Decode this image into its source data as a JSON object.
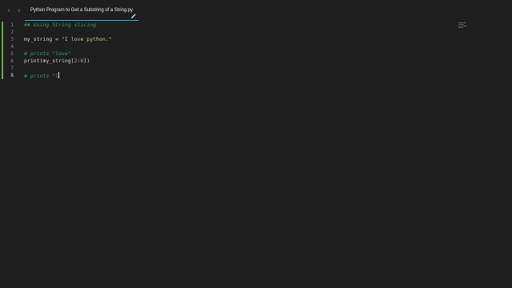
{
  "window": {
    "tab_title": "Python Program to Get a Substring of a String.py",
    "nav_back_icon": "chevron-left",
    "nav_forward_icon": "chevron-right",
    "tab_icon": "pencil-icon",
    "accent_color": "#2fb5c7"
  },
  "editor": {
    "active_line": 8,
    "modified_line_color": "#6fa04a",
    "lines": [
      {
        "number": "1",
        "tokens": [
          {
            "type": "comment",
            "text": "## Using String slicing"
          }
        ]
      },
      {
        "number": "2",
        "tokens": []
      },
      {
        "number": "3",
        "tokens": [
          {
            "type": "ident",
            "text": "my_string"
          },
          {
            "type": "op",
            "text": " = "
          },
          {
            "type": "str",
            "text": "\"I love python.\""
          }
        ]
      },
      {
        "number": "4",
        "tokens": []
      },
      {
        "number": "5",
        "tokens": [
          {
            "type": "comment",
            "text": "# prints \"love\""
          }
        ]
      },
      {
        "number": "6",
        "tokens": [
          {
            "type": "fn",
            "text": "print"
          },
          {
            "type": "bracket",
            "text": "("
          },
          {
            "type": "ident",
            "text": "my_string"
          },
          {
            "type": "bracket",
            "text": "["
          },
          {
            "type": "num",
            "text": "2"
          },
          {
            "type": "op",
            "text": ":"
          },
          {
            "type": "num",
            "text": "6"
          },
          {
            "type": "bracket",
            "text": "])"
          }
        ]
      },
      {
        "number": "7",
        "tokens": []
      },
      {
        "number": "8",
        "tokens": [
          {
            "type": "comment",
            "text": "# prints \"l"
          }
        ]
      }
    ]
  }
}
